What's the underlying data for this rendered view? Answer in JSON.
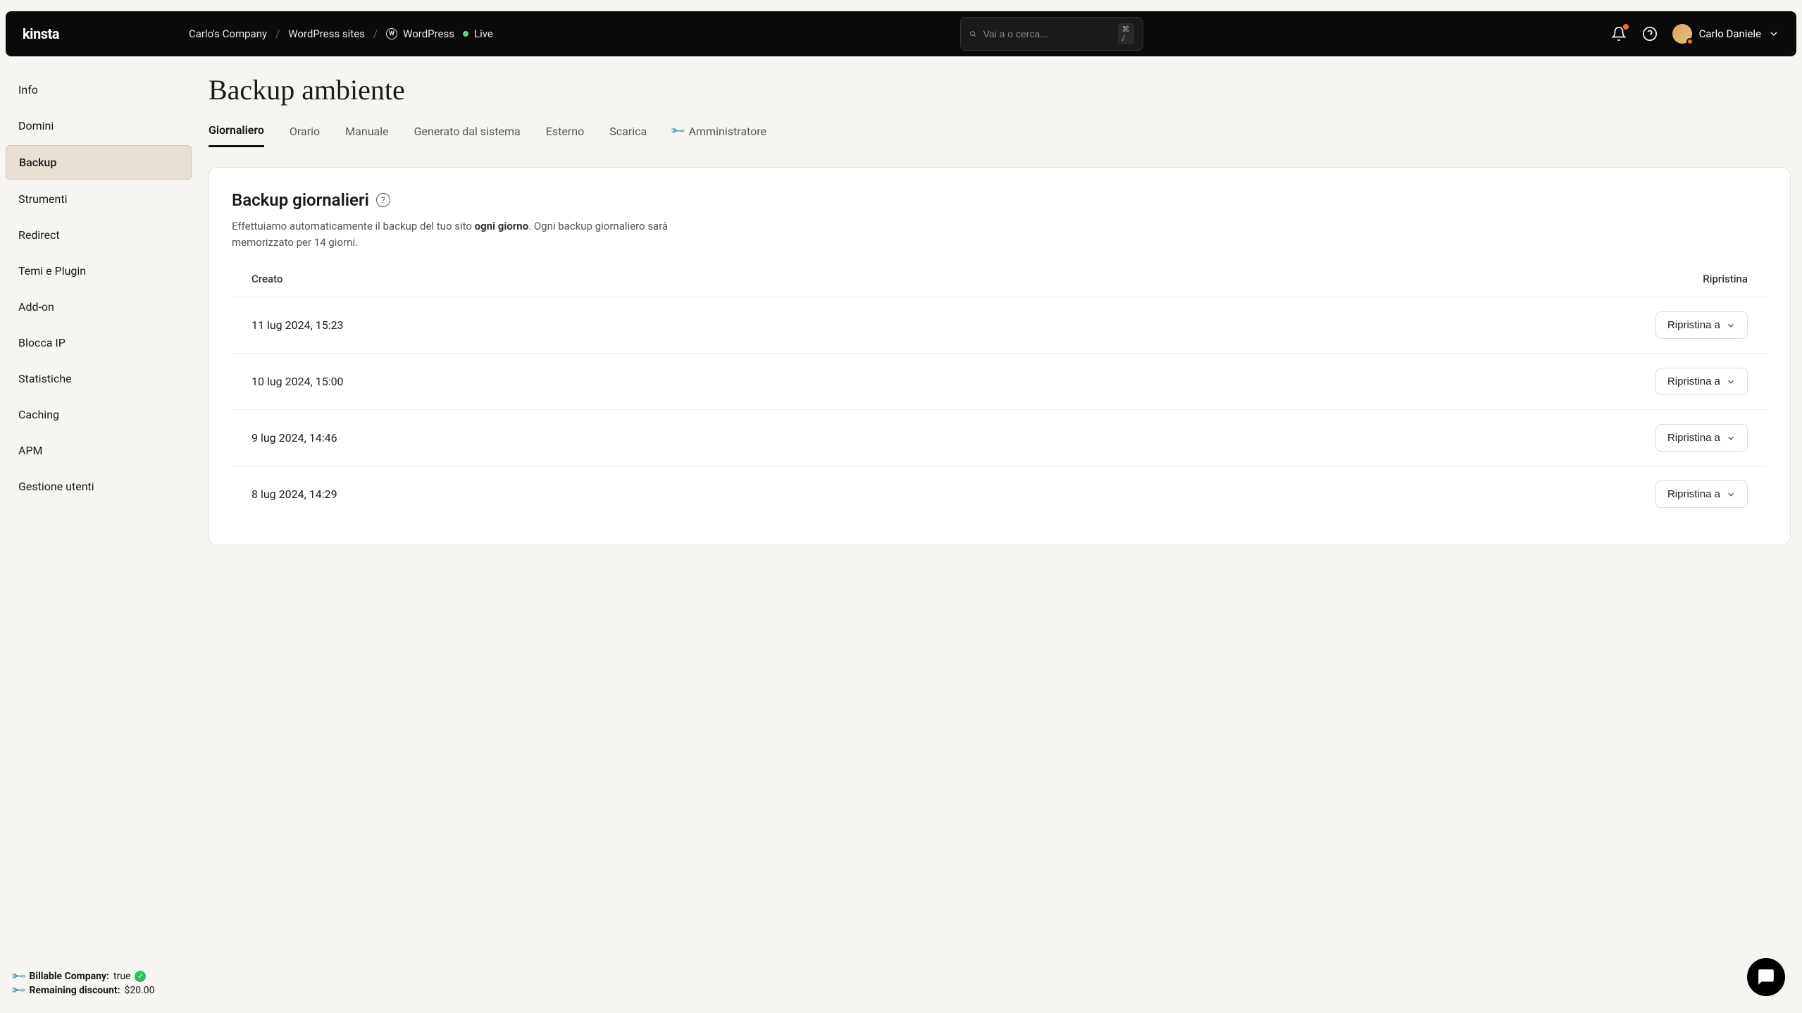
{
  "header": {
    "logo": "kinsta",
    "breadcrumbs": {
      "company": "Carlo's Company",
      "sites": "WordPress sites",
      "site": "WordPress",
      "env": "Live"
    },
    "search": {
      "placeholder": "Vai a o cerca...",
      "shortcut": "⌘ /"
    },
    "user": {
      "name": "Carlo Daniele"
    }
  },
  "sidebar": {
    "items": [
      {
        "label": "Info"
      },
      {
        "label": "Domini"
      },
      {
        "label": "Backup",
        "active": true
      },
      {
        "label": "Strumenti"
      },
      {
        "label": "Redirect"
      },
      {
        "label": "Temi e Plugin"
      },
      {
        "label": "Add-on"
      },
      {
        "label": "Blocca IP"
      },
      {
        "label": "Statistiche"
      },
      {
        "label": "Caching"
      },
      {
        "label": "APM"
      },
      {
        "label": "Gestione utenti"
      }
    ],
    "footer": {
      "billable_label": "Billable Company:",
      "billable_value": "true",
      "discount_label": "Remaining discount:",
      "discount_value": "$20.00"
    }
  },
  "main": {
    "title": "Backup ambiente",
    "tabs": [
      {
        "label": "Giornaliero",
        "active": true
      },
      {
        "label": "Orario"
      },
      {
        "label": "Manuale"
      },
      {
        "label": "Generato dal sistema"
      },
      {
        "label": "Esterno"
      },
      {
        "label": "Scarica"
      },
      {
        "label": "Amministratore",
        "admin": true
      }
    ],
    "card": {
      "title": "Backup giornalieri",
      "desc_pre": "Effettuiamo automaticamente il backup del tuo sito ",
      "desc_bold": "ogni giorno",
      "desc_post": ". Ogni backup giornaliero sarà memorizzato per 14 giorni.",
      "col_created": "Creato",
      "col_restore": "Ripristina",
      "restore_label": "Ripristina a",
      "rows": [
        {
          "created": "11 lug 2024, 15:23"
        },
        {
          "created": "10 lug 2024, 15:00"
        },
        {
          "created": "9 lug 2024, 14:46"
        },
        {
          "created": "8 lug 2024, 14:29"
        }
      ]
    }
  }
}
